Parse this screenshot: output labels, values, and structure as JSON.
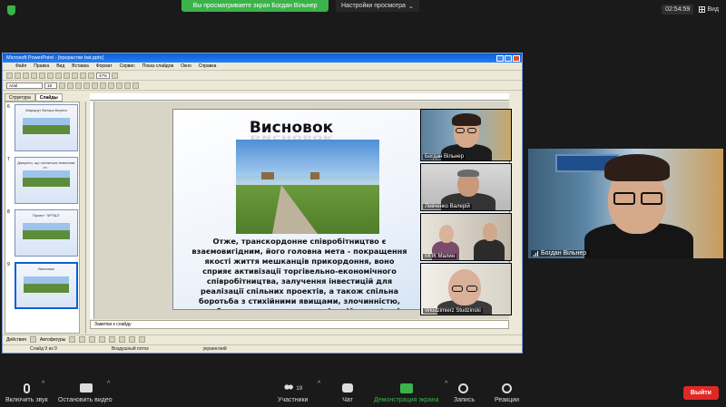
{
  "zoom": {
    "share_banner": "Вы просматриваете экран Богдан Вільнер",
    "view_options": "Настройки просмотра",
    "timer": "02:54:59",
    "view_label": "Вид",
    "controls": {
      "unmute": "Включить звук",
      "start_video": "Остановить видео",
      "participants": "Участники",
      "participants_count": "19",
      "chat": "Чат",
      "share": "Демонстрация экрана",
      "record": "Запись",
      "reactions": "Реакции",
      "leave": "Выйти"
    },
    "accent_green": "#3bb34a",
    "leave_red": "#e02828"
  },
  "ppt": {
    "window_title": "Microsoft PowerPoint - [прорастки bat.pptx]",
    "menu": [
      "Файл",
      "Правка",
      "Вид",
      "Вставка",
      "Формат",
      "Сервис",
      "Показ слайдов",
      "Окно",
      "Справка"
    ],
    "font_name": "Arial",
    "font_size": "18",
    "zoom_level": "47%",
    "tabs": [
      "Структура",
      "Слайды"
    ],
    "thumbnails": [
      {
        "num": "6",
        "title": "Маршрут Батори Берега"
      },
      {
        "num": "7",
        "title": "Джерело, що стелиться чемпіонат ст..."
      },
      {
        "num": "8",
        "title": "Проект \"ЧРП&2\""
      },
      {
        "num": "9",
        "title": "Висновок"
      }
    ],
    "notes_placeholder": "Заметки к слайду",
    "draw_actions": "Действия",
    "draw_autoshapes": "Автофигуры",
    "status_slide": "Слайд 9 из 9",
    "status_design": "Воздушный поток",
    "status_lang": "украинский",
    "slide": {
      "title": "Висновок",
      "body": "Отже, транскордонне співробітництво є взаємовигідним, його головна мета - покращення якості життя мешканців прикордоння, воно сприяє активізації торгівельно-економічного співробітництва, залучення інвестицій для реалізації спільних проектів, а також спільна боротьба з стихійними явищами, злочинністю, поглиблення культурних комунікаційних зв'язків, розвиток туризму."
    }
  },
  "participants": [
    {
      "name": "Богдан Вільнер"
    },
    {
      "name": "Левченко Валерій"
    },
    {
      "name": "МПК Малин"
    },
    {
      "name": "Wlodzimierz Studzinski"
    }
  ],
  "speaker": {
    "name": "Богдан Вільнер"
  }
}
